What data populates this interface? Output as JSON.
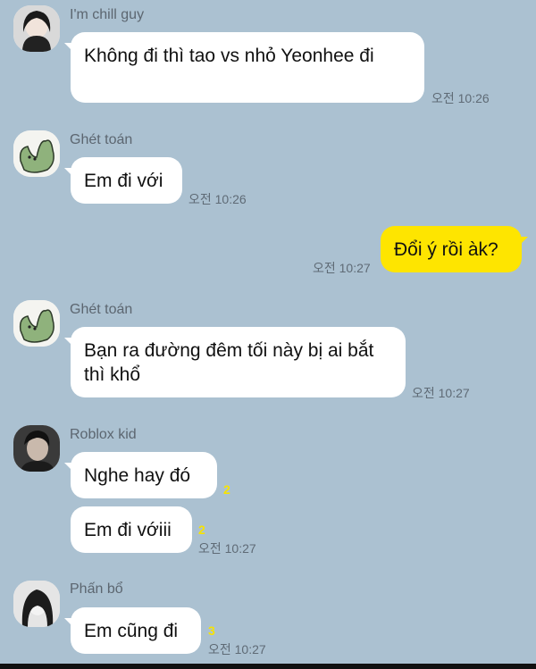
{
  "messages": {
    "m1": {
      "sender": "I'm chill guy",
      "text": "Không đi thì tao vs nhỏ Yeonhee đi",
      "time": "오전 10:26"
    },
    "m2": {
      "sender": "Ghét toán",
      "text": "Em đi với",
      "time": "오전 10:26"
    },
    "m3": {
      "text": "Đổi ý rồi àk?",
      "time": "오전 10:27"
    },
    "m4": {
      "sender": "Ghét toán",
      "text": "Bạn ra đường đêm tối này bị ai bắt thì khổ",
      "time": "오전 10:27"
    },
    "m5": {
      "sender": "Roblox kid",
      "text": "Nghe hay đó",
      "unread": "2"
    },
    "m6": {
      "text": "Em đi vớiii",
      "unread": "2",
      "time": "오전 10:27"
    },
    "m7": {
      "sender": "Phấn bổ",
      "text": "Em cũng đi",
      "unread": "3",
      "time": "오전 10:27"
    }
  },
  "colors": {
    "background": "#abc1d1",
    "my_bubble": "#fee500",
    "other_bubble": "#ffffff",
    "unread_count": "#f7e300"
  },
  "icons": {
    "avatar1": "profile-photo",
    "avatar2": "green-cartoon-foot",
    "avatar3": "profile-photo",
    "avatar4": "profile-photo"
  }
}
